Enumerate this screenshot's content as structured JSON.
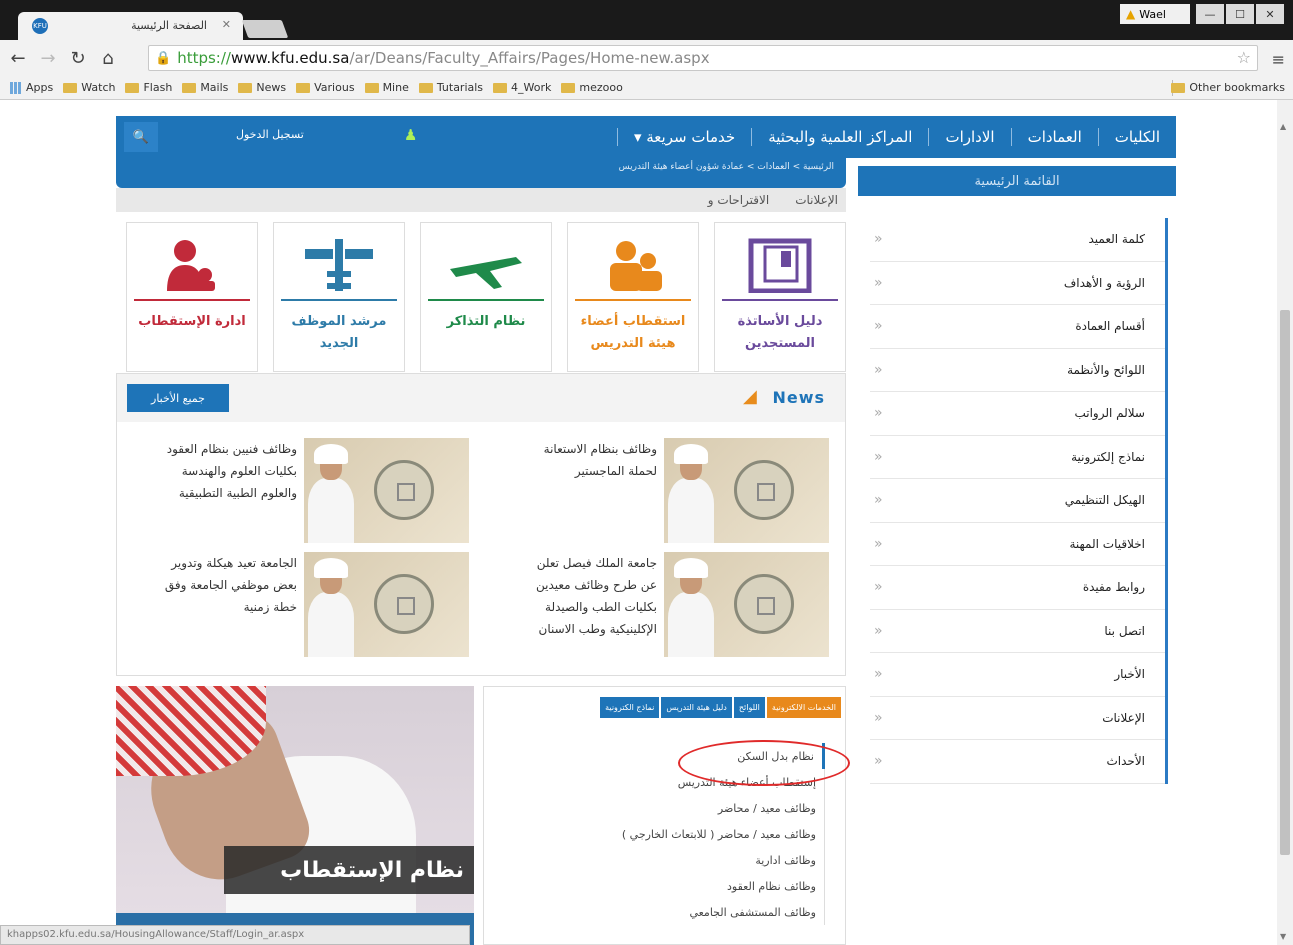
{
  "browser": {
    "tab_title": "الصفحة الرئيسية",
    "tab_favicon": "KFU",
    "user_name": "Wael",
    "url_scheme": "https://",
    "url_host": "www.kfu.edu.sa",
    "url_path": "/ar/Deans/Faculty_Affairs/Pages/Home-new.aspx",
    "bookmarks": [
      "Apps",
      "Watch",
      "Flash",
      "Mails",
      "News",
      "Various",
      "Mine",
      "Tutarials",
      "4_Work",
      "mezooo"
    ],
    "other_bookmarks": "Other bookmarks",
    "status_url": "khapps02.kfu.edu.sa/HousingAllowance/Staff/Login_ar.aspx"
  },
  "topnav": {
    "items": [
      "الكليات",
      "العمادات",
      "الادارات",
      "المراكز العلمية والبحثية",
      "خدمات سريعة ▾"
    ],
    "login": "تسجيل الدخول"
  },
  "breadcrumb": "الرئيسية  >  العمادات  >  عمادة شؤون أعضاء هيئة التدريس",
  "content_tabs": [
    "الإعلانات",
    "الاقتراحات و"
  ],
  "sidebar": {
    "title": "القائمة الرئيسية",
    "items": [
      "كلمة العميد",
      "الرؤية و الأهداف",
      "أقسام العمادة",
      "اللوائح والأنظمة",
      "سلالم الرواتب",
      "نماذج إلكترونية",
      "الهيكل التنظيمي",
      "اخلاقيات المهنة",
      "روابط مفيدة",
      "اتصل بنا",
      "الأخبار",
      "الإعلانات",
      "الأحداث"
    ]
  },
  "cards": [
    {
      "label1": "دليل الأساتذة",
      "label2": "المستجدين",
      "color": "#6a4a9c"
    },
    {
      "label1": "استقطاب أعضاء",
      "label2": "هيئة التدريس",
      "color": "#e8891c"
    },
    {
      "label1": "نظام التذاكر",
      "label2": "",
      "color": "#1f8a4a"
    },
    {
      "label1": "مرشد الموظف",
      "label2": "الجديد",
      "color": "#2d7ba8"
    },
    {
      "label1": "ادارة الإستقطاب",
      "label2": "",
      "color": "#c12a3a"
    }
  ],
  "news": {
    "title": "News",
    "all_button": "جميع الأخبار",
    "items": [
      {
        "l1": "وظائف بنظام الاستعانة",
        "l2": "لحملة الماجستير",
        "l3": "",
        "l4": ""
      },
      {
        "l1": "وظائف فنيين بنظام العقود",
        "l2": "بكليات العلوم والهندسة",
        "l3": "والعلوم الطبية التطبيقية",
        "l4": ""
      },
      {
        "l1": "جامعة الملك فيصل تعلن",
        "l2": "عن طرح وظائف معيدين",
        "l3": "بكليات الطب والصيدلة",
        "l4": "الإكلينيكية وطب الاسنان"
      },
      {
        "l1": "الجامعة تعيد هيكلة وتدوير",
        "l2": "بعض موظفي الجامعة وفق",
        "l3": "خطة زمنية",
        "l4": ""
      }
    ]
  },
  "promo_caption": "نظام الإستقطاب",
  "eservices": {
    "tabs": [
      "الخدمات الالكترونية",
      "اللوائح",
      "دليل هيئة التدريس",
      "نماذج الكترونية"
    ],
    "items": [
      "نظام بدل السكن",
      "إستقطاب أعضاء هيئة التدريس",
      "وظائف معيد / محاضر",
      "وظائف معيد / محاضر ( للابتعاث الخارجي )",
      "وظائف ادارية",
      "وظائف نظام العقود",
      "وظائف المستشفى الجامعي"
    ]
  }
}
